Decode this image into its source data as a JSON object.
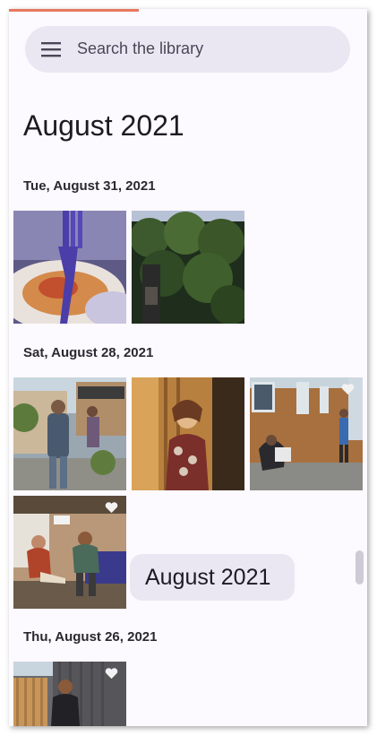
{
  "search": {
    "placeholder": "Search the library",
    "icon": "menu-icon"
  },
  "library": {
    "month_title": "August 2021",
    "sections": [
      {
        "date": "Tue, August 31, 2021",
        "photos": [
          "fork-and-plate",
          "ivy-covered-building"
        ]
      },
      {
        "date": "Sat, August 28, 2021",
        "photos": [
          "man-photographing-woman",
          "woman-in-golden-light",
          "photographer-crouching-street",
          "couple-on-balcony"
        ]
      },
      {
        "date": "Thu, August 26, 2021",
        "photos": [
          "man-sitting-by-fence"
        ]
      }
    ]
  },
  "scroll_bubble": {
    "label": "August 2021"
  },
  "colors": {
    "surface": "#fcf9ff",
    "search_bg": "#ebe7f2",
    "accent_line": "#e8785c"
  },
  "favorites": {
    "favorited_photos": [
      "photographer-crouching-street",
      "couple-on-balcony",
      "man-sitting-by-fence"
    ]
  }
}
